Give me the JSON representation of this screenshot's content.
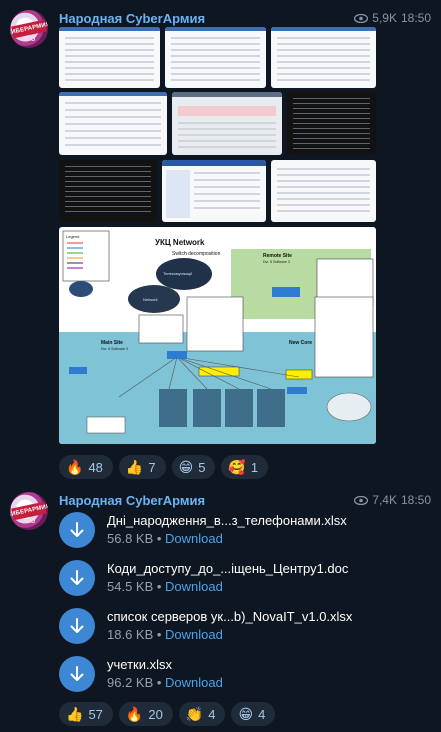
{
  "posts": [
    {
      "channel": "Народная CyberАрмия",
      "views": "5,9K",
      "time": "18:50",
      "avatar_text": "КИБЕРАРМИЯ",
      "avatar_sub": "ЗЛО",
      "diagram": {
        "title": "УКЦ Network",
        "subtitle": "Switch decomposition",
        "legend_title": "Legend",
        "remote_site": "Remote Site",
        "remote_sub": "Dvr. 6 Software 3",
        "main_site": "Main Site",
        "main_sub": "Dvr. 6 Software 3",
        "new_core": "New Core",
        "cloud1": "Телекомунікації",
        "cloud2": "Network"
      },
      "reactions": [
        {
          "emoji": "🔥",
          "count": "48"
        },
        {
          "emoji": "👍",
          "count": "7"
        },
        {
          "emoji": "😁",
          "count": "5"
        },
        {
          "emoji": "🥰",
          "count": "1"
        }
      ]
    },
    {
      "channel": "Народная CyberАрмия",
      "views": "7,4K",
      "time": "18:50",
      "avatar_text": "КИБЕРАРМИЯ",
      "avatar_sub": "ЗЛО",
      "files": [
        {
          "name": "Дні_народження_в...з_телефонами.xlsx",
          "size": "56.8 KB",
          "action": "Download"
        },
        {
          "name": "Коди_доступу_до_...іщень_Центру1.doc",
          "size": "54.5 KB",
          "action": "Download"
        },
        {
          "name": "список серверов ук...b)_NovaIT_v1.0.xlsx",
          "size": "18.6 KB",
          "action": "Download"
        },
        {
          "name": "учетки.xlsx",
          "size": "96.2 KB",
          "action": "Download"
        }
      ],
      "reactions": [
        {
          "emoji": "👍",
          "count": "57"
        },
        {
          "emoji": "🔥",
          "count": "20"
        },
        {
          "emoji": "👏",
          "count": "4"
        },
        {
          "emoji": "😁",
          "count": "4"
        }
      ]
    }
  ]
}
